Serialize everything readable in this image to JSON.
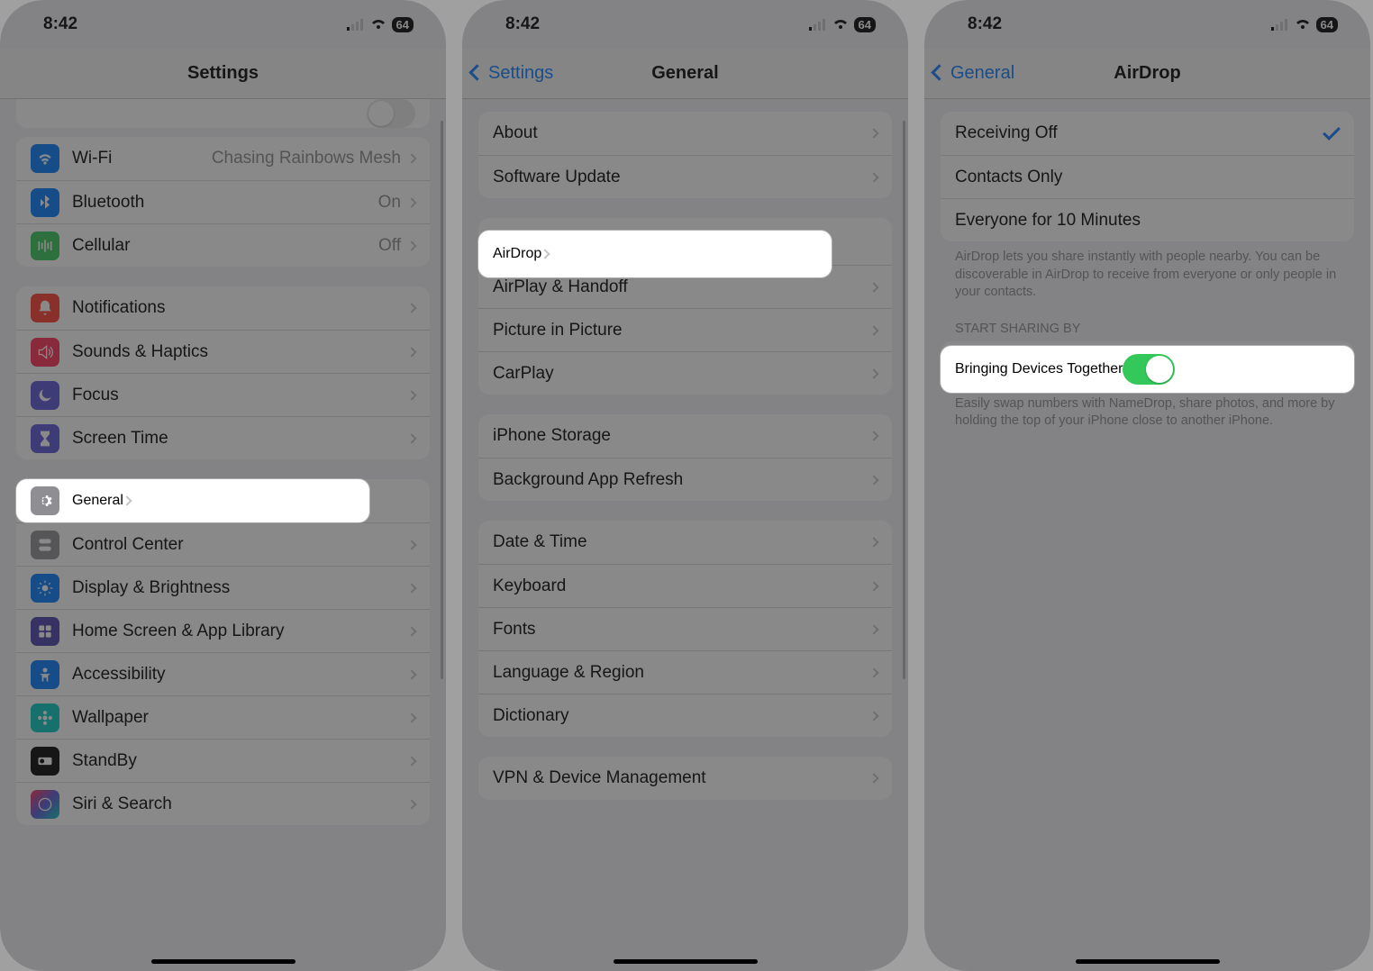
{
  "status": {
    "time": "8:42",
    "battery": "64"
  },
  "screen1": {
    "title": "Settings",
    "partial_row": {
      "toggle": false
    },
    "group1": [
      {
        "icon": "wifi",
        "bg": "#007aff",
        "label": "Wi-Fi",
        "value": "Chasing Rainbows Mesh"
      },
      {
        "icon": "bluetooth",
        "bg": "#007aff",
        "label": "Bluetooth",
        "value": "On"
      },
      {
        "icon": "cellular",
        "bg": "#34c759",
        "label": "Cellular",
        "value": "Off"
      }
    ],
    "group2": [
      {
        "icon": "bell",
        "bg": "#ff3b30",
        "label": "Notifications"
      },
      {
        "icon": "speaker",
        "bg": "#ff2d55",
        "label": "Sounds & Haptics"
      },
      {
        "icon": "moon",
        "bg": "#5856d6",
        "label": "Focus"
      },
      {
        "icon": "hourglass",
        "bg": "#5856d6",
        "label": "Screen Time"
      }
    ],
    "group3": [
      {
        "icon": "gear",
        "bg": "#8e8e93",
        "label": "General",
        "highlight": true
      },
      {
        "icon": "switches",
        "bg": "#8e8e93",
        "label": "Control Center"
      },
      {
        "icon": "sun",
        "bg": "#007aff",
        "label": "Display & Brightness"
      },
      {
        "icon": "grid",
        "bg": "#4b3fae",
        "label": "Home Screen & App Library"
      },
      {
        "icon": "person",
        "bg": "#007aff",
        "label": "Accessibility"
      },
      {
        "icon": "flower",
        "bg": "#00c7be",
        "label": "Wallpaper"
      },
      {
        "icon": "clock",
        "bg": "#000000",
        "label": "StandBy"
      },
      {
        "icon": "siri",
        "bg": "#1c1c1e",
        "label": "Siri & Search"
      }
    ]
  },
  "screen2": {
    "back": "Settings",
    "title": "General",
    "group1": [
      {
        "label": "About"
      },
      {
        "label": "Software Update"
      }
    ],
    "group2": [
      {
        "label": "AirDrop",
        "highlight": true
      },
      {
        "label": "AirPlay & Handoff"
      },
      {
        "label": "Picture in Picture"
      },
      {
        "label": "CarPlay"
      }
    ],
    "group3": [
      {
        "label": "iPhone Storage"
      },
      {
        "label": "Background App Refresh"
      }
    ],
    "group4": [
      {
        "label": "Date & Time"
      },
      {
        "label": "Keyboard"
      },
      {
        "label": "Fonts"
      },
      {
        "label": "Language & Region"
      },
      {
        "label": "Dictionary"
      }
    ],
    "group5": [
      {
        "label": "VPN & Device Management"
      }
    ]
  },
  "screen3": {
    "back": "General",
    "title": "AirDrop",
    "receiving": [
      {
        "label": "Receiving Off",
        "checked": true
      },
      {
        "label": "Contacts Only",
        "checked": false
      },
      {
        "label": "Everyone for 10 Minutes",
        "checked": false
      }
    ],
    "receiving_note": "AirDrop lets you share instantly with people nearby. You can be discoverable in AirDrop to receive from everyone or only people in your contacts.",
    "section_header": "START SHARING BY",
    "toggle_row": {
      "label": "Bringing Devices Together",
      "on": true,
      "highlight": true
    },
    "toggle_note": "Easily swap numbers with NameDrop, share photos, and more by holding the top of your iPhone close to another iPhone."
  }
}
